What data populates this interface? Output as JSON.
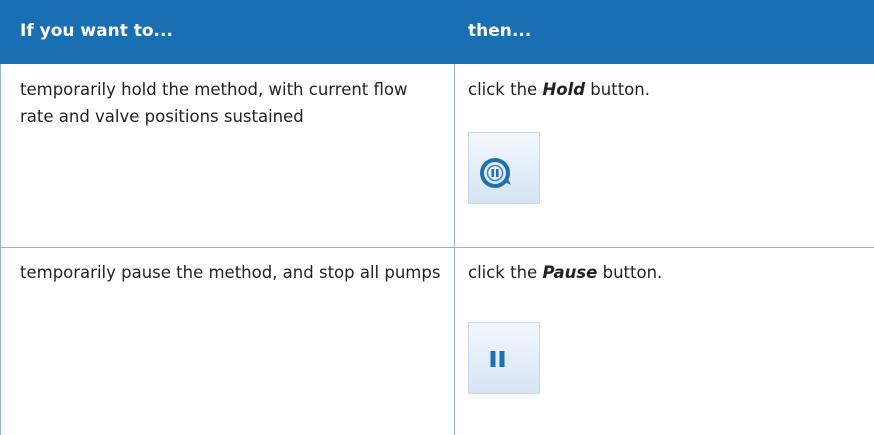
{
  "table": {
    "header": {
      "col1": "If you want to...",
      "col2": "then..."
    },
    "rows": [
      {
        "condition": "temporarily hold the method, with current flow rate and valve positions sustained",
        "action_prefix": "click the ",
        "action_emphasis": "Hold",
        "action_suffix": " button.",
        "icon": "hold-button-icon"
      },
      {
        "condition": "temporarily pause the method, and stop all pumps",
        "action_prefix": "click the ",
        "action_emphasis": "Pause",
        "action_suffix": " button.",
        "icon": "pause-button-icon"
      }
    ]
  },
  "colors": {
    "header_background": "#1a6fb3",
    "header_text": "#ffffff",
    "grid_lines": "#8fb4d6",
    "icon_blue": "#1f6fb5"
  }
}
